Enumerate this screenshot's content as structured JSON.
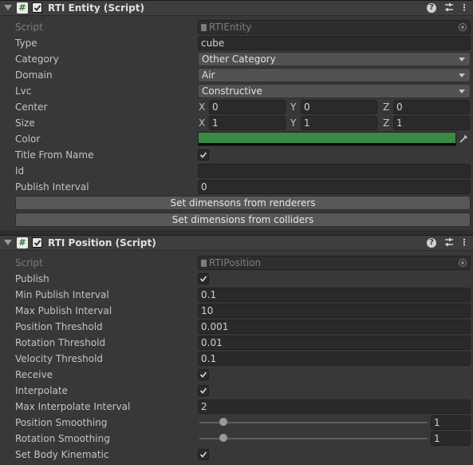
{
  "entity": {
    "title": "RTI Entity (Script)",
    "script_label": "Script",
    "script_value": "RTIEntity",
    "type_label": "Type",
    "type_value": "cube",
    "category_label": "Category",
    "category_value": "Other Category",
    "domain_label": "Domain",
    "domain_value": "Air",
    "lvc_label": "Lvc",
    "lvc_value": "Constructive",
    "center_label": "Center",
    "center": {
      "x_label": "X",
      "x": "0",
      "y_label": "Y",
      "y": "0",
      "z_label": "Z",
      "z": "0"
    },
    "size_label": "Size",
    "size": {
      "x_label": "X",
      "x": "1",
      "y_label": "Y",
      "y": "1",
      "z_label": "Z",
      "z": "1"
    },
    "color_label": "Color",
    "color_value": "#3a8a45",
    "title_from_name_label": "Title From Name",
    "title_from_name_checked": true,
    "id_label": "Id",
    "id_value": "",
    "publish_interval_label": "Publish Interval",
    "publish_interval_value": "0",
    "btn_renderers": "Set dimensons from renderers",
    "btn_colliders": "Set dimensions from colliders"
  },
  "position": {
    "title": "RTI Position (Script)",
    "script_label": "Script",
    "script_value": "RTIPosition",
    "publish_label": "Publish",
    "min_publish_label": "Min Publish Interval",
    "min_publish_value": "0.1",
    "max_publish_label": "Max Publish Interval",
    "max_publish_value": "10",
    "pos_threshold_label": "Position Threshold",
    "pos_threshold_value": "0.001",
    "rot_threshold_label": "Rotation Threshold",
    "rot_threshold_value": "0.01",
    "vel_threshold_label": "Velocity Threshold",
    "vel_threshold_value": "0.1",
    "receive_label": "Receive",
    "interpolate_label": "Interpolate",
    "max_interp_label": "Max Interpolate Interval",
    "max_interp_value": "2",
    "pos_smoothing_label": "Position Smoothing",
    "pos_smoothing_value": "1",
    "rot_smoothing_label": "Rotation Smoothing",
    "rot_smoothing_value": "1",
    "set_body_kinematic_label": "Set Body Kinematic"
  },
  "header_icons": {
    "help": "?",
    "menu": "⋮"
  }
}
